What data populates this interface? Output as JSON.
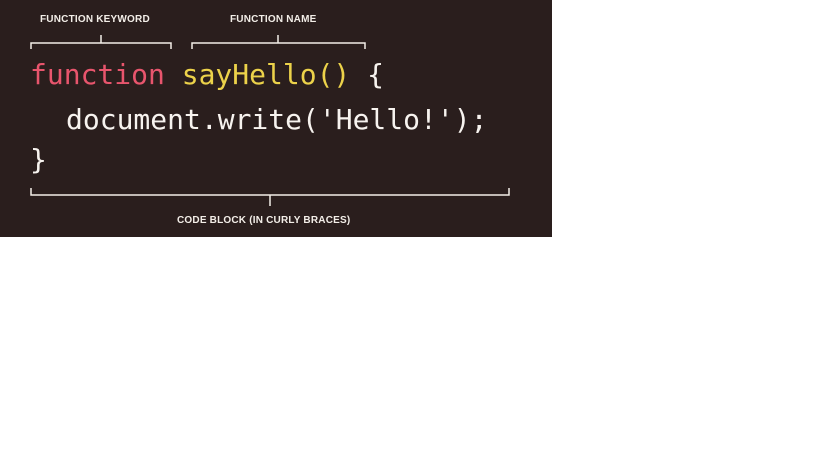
{
  "labels": {
    "keyword": "FUNCTION KEYWORD",
    "name": "FUNCTION NAME",
    "block": "CODE BLOCK (IN CURLY BRACES)"
  },
  "code": {
    "line1_keyword": "function",
    "line1_name": "sayHello()",
    "line1_brace": "{",
    "line2": "document.write('Hello!');",
    "line3": "}"
  },
  "colors": {
    "background": "#2a1e1d",
    "keyword": "#e8556d",
    "function_name": "#ecd24a",
    "text": "#f7f3ef",
    "bracket": "#f3eee8"
  }
}
